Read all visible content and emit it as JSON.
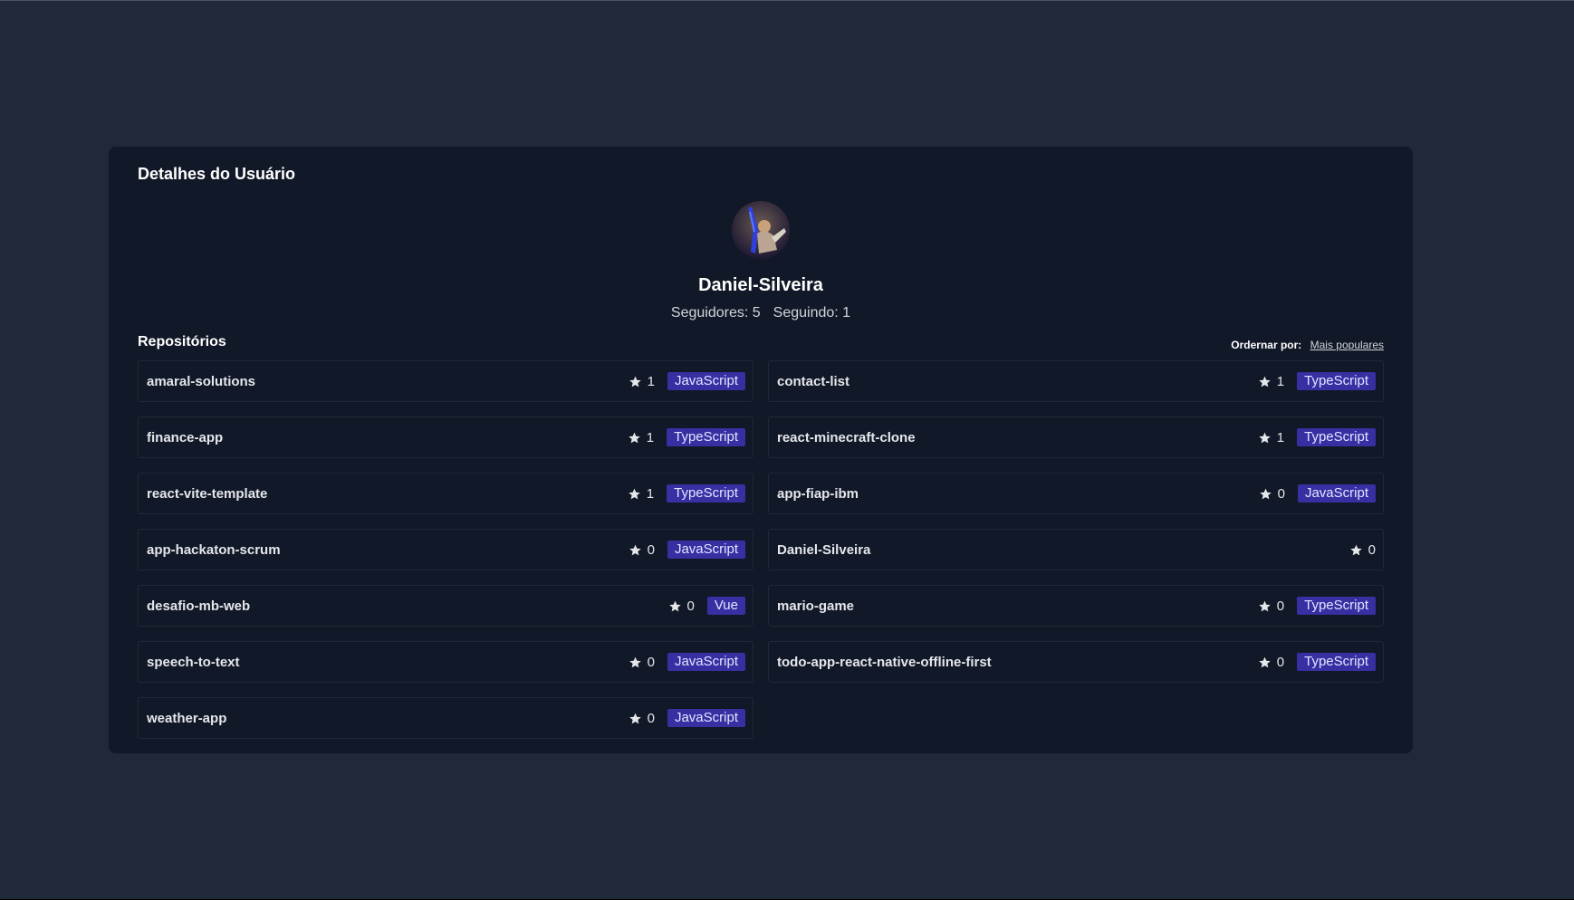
{
  "card": {
    "title": "Detalhes do Usuário"
  },
  "user": {
    "name": "Daniel-Silveira",
    "followers_label": "Seguidores: 5",
    "following_label": "Seguindo: 1"
  },
  "repositories": {
    "title": "Repositórios",
    "order_label": "Ordernar por:",
    "order_value": "Mais populares",
    "items": [
      {
        "name": "amaral-solutions",
        "stars": "1",
        "language": "JavaScript"
      },
      {
        "name": "contact-list",
        "stars": "1",
        "language": "TypeScript"
      },
      {
        "name": "finance-app",
        "stars": "1",
        "language": "TypeScript"
      },
      {
        "name": "react-minecraft-clone",
        "stars": "1",
        "language": "TypeScript"
      },
      {
        "name": "react-vite-template",
        "stars": "1",
        "language": "TypeScript"
      },
      {
        "name": "app-fiap-ibm",
        "stars": "0",
        "language": "JavaScript"
      },
      {
        "name": "app-hackaton-scrum",
        "stars": "0",
        "language": "JavaScript"
      },
      {
        "name": "Daniel-Silveira",
        "stars": "0",
        "language": ""
      },
      {
        "name": "desafio-mb-web",
        "stars": "0",
        "language": "Vue"
      },
      {
        "name": "mario-game",
        "stars": "0",
        "language": "TypeScript"
      },
      {
        "name": "speech-to-text",
        "stars": "0",
        "language": "JavaScript"
      },
      {
        "name": "todo-app-react-native-offline-first",
        "stars": "0",
        "language": "TypeScript"
      },
      {
        "name": "weather-app",
        "stars": "0",
        "language": "JavaScript"
      }
    ]
  },
  "colors": {
    "page_bg": "#1f2937",
    "card_bg": "#111827",
    "badge_bg": "#3730a3"
  },
  "icons": {
    "star": "star-icon"
  }
}
